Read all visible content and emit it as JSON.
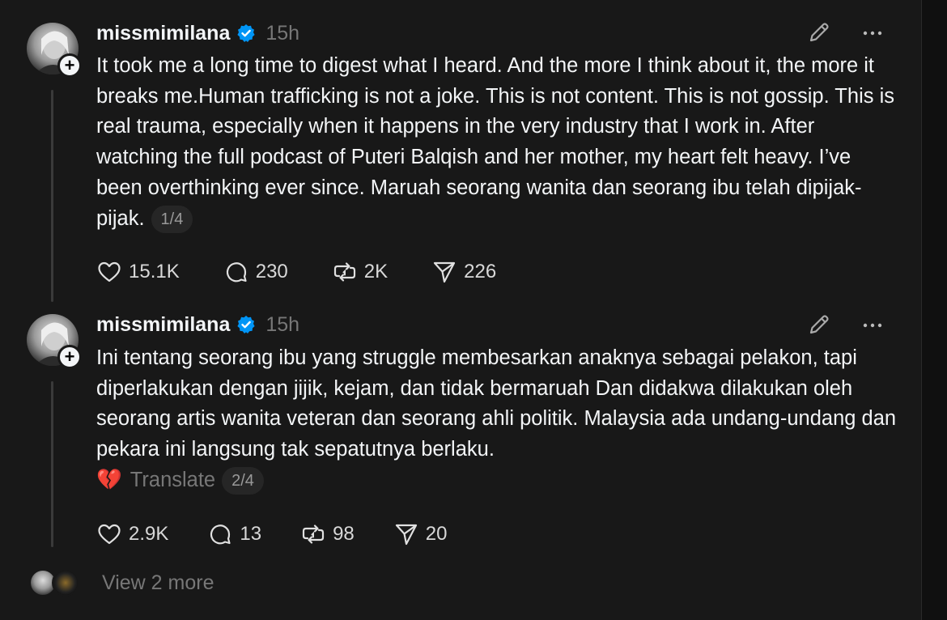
{
  "posts": [
    {
      "username": "missmimilana",
      "time": "15h",
      "text": "It took me a long time to digest what I heard. And the more I think about it, the more it breaks me.Human trafficking is not a joke. This is not content. This is not gossip. This is real trauma, especially when it happens in the very industry that I work in. After watching the full podcast of Puteri Balqish and her mother, my heart felt heavy. I’ve been overthinking ever since. Maruah seorang wanita dan seorang ibu telah dipijak-pijak.",
      "page_indicator": "1/4",
      "likes": "15.1K",
      "replies": "230",
      "reposts": "2K",
      "shares": "226"
    },
    {
      "username": "missmimilana",
      "time": "15h",
      "text": "Ini tentang seorang ibu yang struggle membesarkan anaknya sebagai pelakon, tapi diperlakukan dengan jijik, kejam, dan tidak bermaruah Dan didakwa dilakukan oleh seorang artis wanita veteran dan seorang ahli politik. Malaysia ada undang-undang dan pekara ini langsung tak sepatutnya berlaku.",
      "emoji": "💔",
      "translate_label": "Translate",
      "page_indicator": "2/4",
      "likes": "2.9K",
      "replies": "13",
      "reposts": "98",
      "shares": "20"
    }
  ],
  "view_more": "View 2 more",
  "colors": {
    "background": "#181818",
    "text": "#f3f5f7",
    "muted": "#777777",
    "verified": "#0095f6"
  }
}
